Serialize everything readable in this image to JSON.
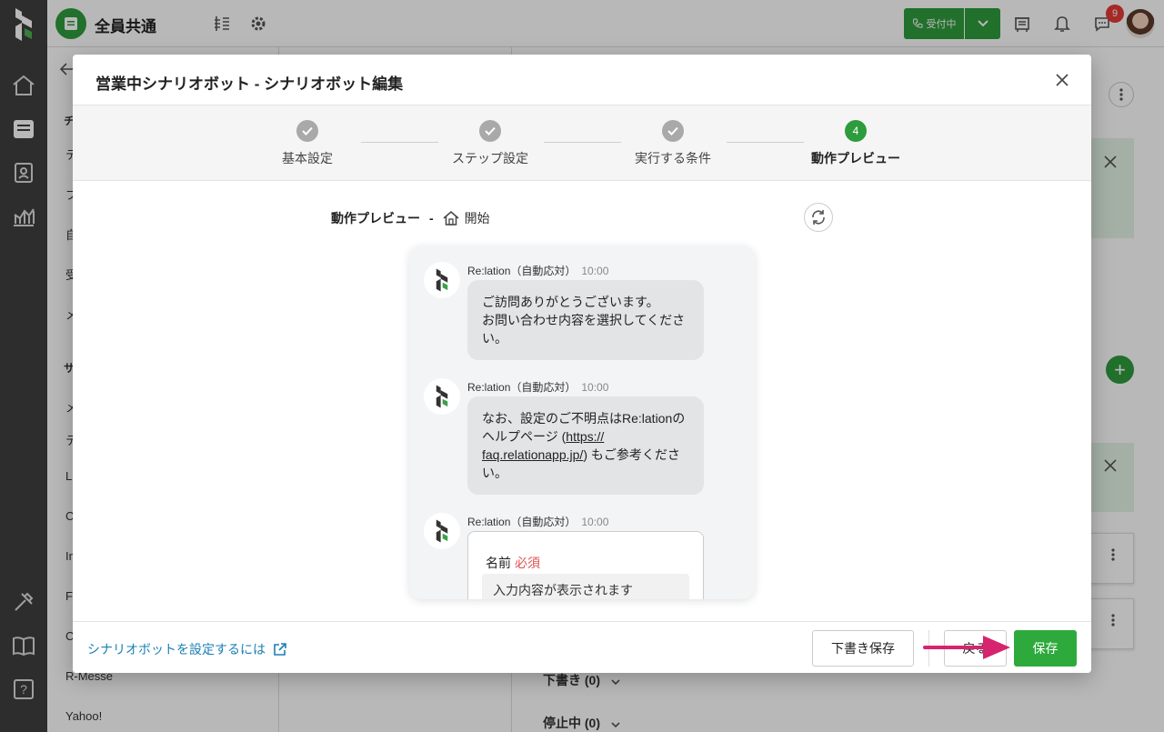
{
  "workspace": {
    "name": "全員共通"
  },
  "status": {
    "label": "受付中",
    "notification_count": "9"
  },
  "side": {
    "items": [
      "チ",
      "テ",
      "ブ",
      "自",
      "受",
      "メ",
      "サ",
      "メ",
      "テ",
      "L",
      "C",
      "In",
      "Fa",
      "C",
      "R-Messe",
      "Yahoo!"
    ]
  },
  "background": {
    "draft_label": "下書き (0)",
    "stopped_label": "停止中 (0)"
  },
  "modal": {
    "title": "営業中シナリオボット - シナリオボット編集",
    "steps": [
      {
        "num": "1",
        "label": "基本設定",
        "state": "done"
      },
      {
        "num": "2",
        "label": "ステップ設定",
        "state": "done"
      },
      {
        "num": "3",
        "label": "実行する条件",
        "state": "done"
      },
      {
        "num": "4",
        "label": "動作プレビュー",
        "state": "active"
      }
    ],
    "preview": {
      "heading": "動作プレビュー",
      "separator": "-",
      "location": "開始"
    },
    "messages": [
      {
        "sender": "Re:lation（自動応対）",
        "time": "10:00",
        "text_lines": [
          "ご訪問ありがとうございます。",
          "お問い合わせ内容を選択してくださ",
          "い。"
        ]
      },
      {
        "sender": "Re:lation（自動応対）",
        "time": "10:00",
        "line1": "なお、設定のご不明点はRe:lationの",
        "line2_prefix": "ヘルプページ (",
        "link1": "https://",
        "link2": "faq.relationapp.jp/",
        "line3_suffix": ") もご参考くださ",
        "line4": "い。"
      },
      {
        "sender": "Re:lation（自動応対）",
        "time": "10:00",
        "field_label": "名前",
        "required": "必須",
        "field_placeholder": "入力内容が表示されます"
      }
    ],
    "footer": {
      "help_link": "シナリオボットを設定するには",
      "draft_save": "下書き保存",
      "back": "戻る",
      "save": "保存"
    }
  },
  "colors": {
    "brand_green": "#2e9b3c",
    "save_green": "#2eaa3c",
    "link_blue": "#1a7fb5",
    "arrow_pink": "#d6246e",
    "required_red": "#e05050"
  }
}
